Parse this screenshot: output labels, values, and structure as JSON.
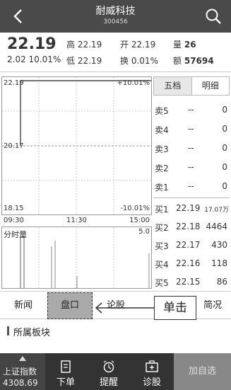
{
  "header": {
    "title": "耐威科技",
    "code": "300456"
  },
  "quote": {
    "price": "22.19",
    "change": "2.02 10.01%",
    "high_label": "高",
    "high": "22.19",
    "open_label": "开",
    "open": "22.19",
    "vol_label": "量",
    "vol": "26",
    "low_label": "低",
    "low": "22.19",
    "turnover_label": "换",
    "turnover": "0.01%",
    "amount_label": "额",
    "amount": "57694"
  },
  "chart": {
    "top_price": "22.19",
    "top_pct": "+10.01%",
    "mid_price": "20.17",
    "bottom_price": "18.15",
    "bottom_pct": "-10.01%",
    "time_start": "09:30",
    "time_mid": "11:30",
    "time_end": "15:00",
    "vol_label": "分时量",
    "vol_max": "5.0"
  },
  "book": {
    "tabs": [
      "五档",
      "明细"
    ],
    "sells": [
      {
        "label": "卖5",
        "price": "--",
        "vol": "0"
      },
      {
        "label": "卖4",
        "price": "--",
        "vol": "0"
      },
      {
        "label": "卖3",
        "price": "--",
        "vol": "0"
      },
      {
        "label": "卖2",
        "price": "--",
        "vol": "0"
      },
      {
        "label": "卖1",
        "price": "--",
        "vol": "0"
      }
    ],
    "buys": [
      {
        "label": "买1",
        "price": "22.19",
        "vol": "17.07万"
      },
      {
        "label": "买2",
        "price": "22.18",
        "vol": "4464"
      },
      {
        "label": "买3",
        "price": "22.17",
        "vol": "430"
      },
      {
        "label": "买4",
        "price": "22.16",
        "vol": "118"
      },
      {
        "label": "买5",
        "price": "22.15",
        "vol": "86"
      }
    ]
  },
  "nav": {
    "news": "新闻",
    "pankou": "盘口",
    "forum": "论股",
    "overview": "简况"
  },
  "callout": "单击",
  "section": {
    "title": "所属板块"
  },
  "toolbar": {
    "index_name": "上证指数",
    "index_value": "4308.69",
    "order": "下单",
    "alert": "提醒",
    "diagnose": "诊股",
    "add": "加自选"
  },
  "colors": {
    "header_bg": "#4a4a4a",
    "toolbar_bg": "#333333",
    "highlight": "#aaaaaa"
  }
}
